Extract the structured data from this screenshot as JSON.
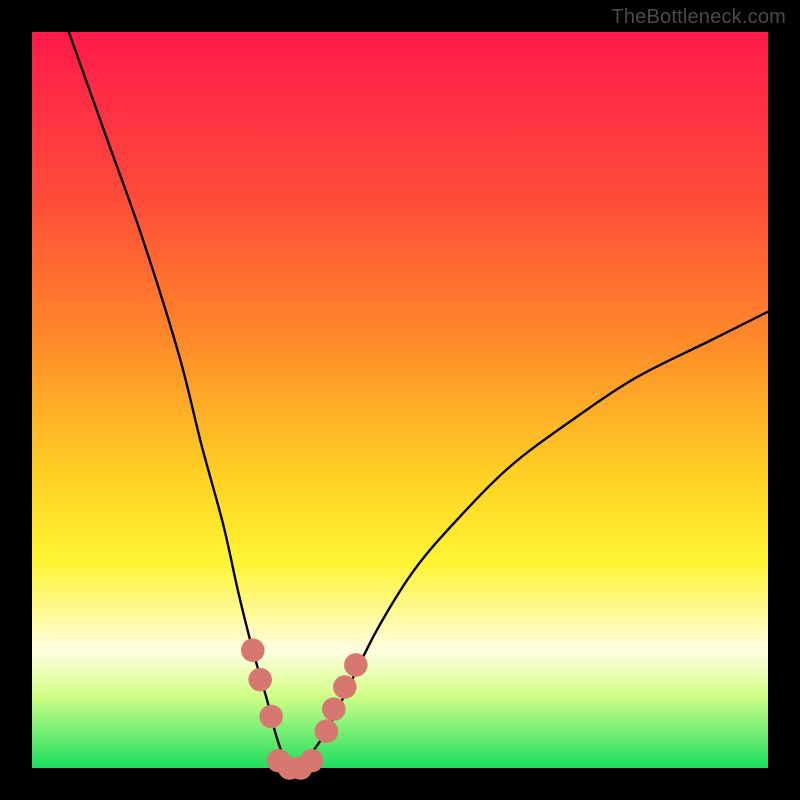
{
  "attribution": "TheBottleneck.com",
  "colors": {
    "gradient_top": "#ff1a4b",
    "gradient_bottom": "#1cde5f",
    "curve": "#000000",
    "marker": "#d6786f",
    "frame": "#000000"
  },
  "chart_data": {
    "type": "line",
    "title": "",
    "xlabel": "",
    "ylabel": "",
    "xlim": [
      0,
      100
    ],
    "ylim": [
      0,
      100
    ],
    "series": [
      {
        "name": "bottleneck-curve",
        "x": [
          5,
          10,
          15,
          20,
          23,
          26,
          28,
          30,
          32,
          33,
          34,
          35,
          36,
          37,
          38,
          40,
          43,
          47,
          52,
          58,
          65,
          73,
          82,
          92,
          100
        ],
        "y": [
          100,
          86,
          72,
          56,
          44,
          33,
          24,
          16,
          9,
          5,
          2,
          0,
          0,
          0,
          2,
          5,
          11,
          19,
          27,
          34,
          41,
          47,
          53,
          58,
          62
        ]
      }
    ],
    "markers": {
      "name": "highlighted-points",
      "points": [
        {
          "x": 30.0,
          "y": 16
        },
        {
          "x": 31.0,
          "y": 12
        },
        {
          "x": 32.5,
          "y": 7
        },
        {
          "x": 33.5,
          "y": 1
        },
        {
          "x": 35.0,
          "y": 0
        },
        {
          "x": 36.5,
          "y": 0
        },
        {
          "x": 38.0,
          "y": 1
        },
        {
          "x": 40.0,
          "y": 5
        },
        {
          "x": 41.0,
          "y": 8
        },
        {
          "x": 42.5,
          "y": 11
        },
        {
          "x": 44.0,
          "y": 14
        }
      ],
      "radius_value_units": 1.6
    }
  }
}
